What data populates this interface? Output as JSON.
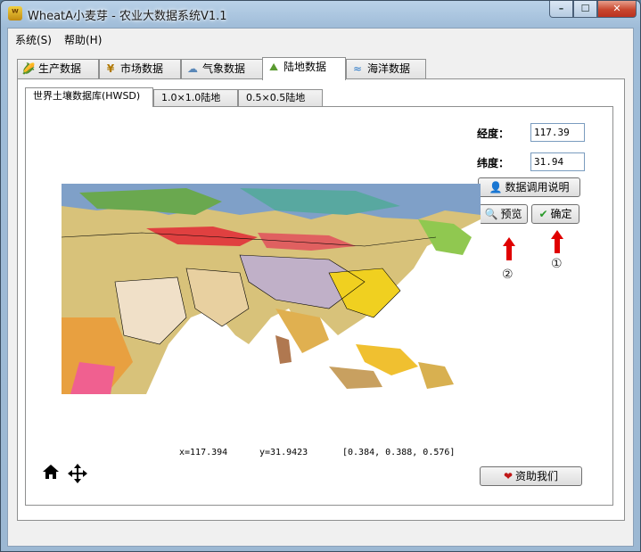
{
  "window": {
    "title": "WheatA小麦芽 - 农业大数据系统V1.1",
    "app_icon": "wheat-icon",
    "controls": [
      "minimize",
      "maximize",
      "close"
    ]
  },
  "menu": {
    "system": "系统(S)",
    "help": "帮助(H)"
  },
  "outer_tabs": [
    {
      "label": "生产数据",
      "icon": "corn-icon"
    },
    {
      "label": "市场数据",
      "icon": "yen-icon"
    },
    {
      "label": "气象数据",
      "icon": "cloud-icon"
    },
    {
      "label": "陆地数据",
      "icon": "land-icon",
      "active": true
    },
    {
      "label": "海洋数据",
      "icon": "ocean-icon"
    }
  ],
  "inner_tabs": [
    {
      "label": "世界土壤数据库(HWSD)",
      "active": true
    },
    {
      "label": "1.0×1.0陆地"
    },
    {
      "label": "0.5×0.5陆地"
    }
  ],
  "form": {
    "longitude_label": "经度：",
    "longitude_value": "117.39",
    "latitude_label": "纬度：",
    "latitude_value": "31.94"
  },
  "buttons": {
    "data_help": "数据调用说明",
    "preview": "预览",
    "confirm": "确定",
    "donate": "资助我们"
  },
  "annotations": {
    "confirm_marker": "①",
    "preview_marker": "②",
    "arrow_color": "#e00000"
  },
  "readout": {
    "x": "x=117.394",
    "y": "y=31.9423",
    "rgb": "[0.384, 0.388, 0.576]"
  },
  "map": {
    "description_icon": "soil-map-image"
  },
  "colors": {
    "accent_blue": "#7a9cbf",
    "close_red": "#c8462e"
  }
}
